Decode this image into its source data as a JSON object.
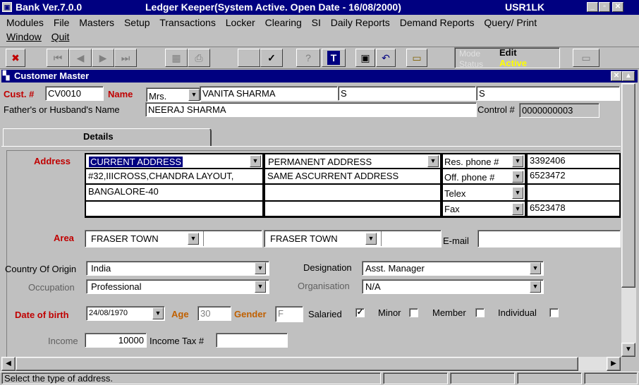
{
  "app": {
    "title_left": "Bank Ver.7.0.0",
    "title_center": "Ledger Keeper(System Active. Open Date - 16/08/2000)",
    "user": "USR1LK"
  },
  "menu": {
    "row1": [
      "Modules",
      "File",
      "Masters",
      "Setup",
      "Transactions",
      "Locker",
      "Clearing",
      "SI",
      "Daily Reports",
      "Demand Reports",
      "Query/ Print"
    ],
    "window": "Window",
    "quit": "Quit"
  },
  "toolbar": {
    "mode_label": "Mode",
    "mode_value": "Edit",
    "status_label": "Status",
    "status_value": "Active",
    "status_color": "#ffff00"
  },
  "child": {
    "title": "Customer Master",
    "close_glyph": "✕"
  },
  "header": {
    "cust_label": "Cust. #",
    "cust_value": "CV0010",
    "name_label": "Name",
    "salutation": "Mrs.",
    "first_name": "VANITA SHARMA",
    "middle": "S",
    "last": "S",
    "father_label": "Father's or Husband's Name",
    "father_value": "NEERAJ SHARMA",
    "control_label": "Control #",
    "control_value": "0000000003"
  },
  "tabs": {
    "details": "Details"
  },
  "address": {
    "label": "Address",
    "current_type": "CURRENT ADDRESS",
    "permanent_type": "PERMANENT ADDRESS",
    "current_lines": [
      "#32,IIICROSS,CHANDRA LAYOUT,",
      "BANGALORE-40",
      ""
    ],
    "permanent_lines": [
      "SAME ASCURRENT ADDRESS",
      "",
      ""
    ],
    "phones": [
      {
        "type": "Res. phone #",
        "value": "3392406"
      },
      {
        "type": "Off. phone #",
        "value": "6523472"
      },
      {
        "type": "Telex",
        "value": ""
      },
      {
        "type": "Fax",
        "value": "6523478"
      }
    ]
  },
  "area": {
    "label": "Area",
    "current": "FRASER TOWN",
    "permanent": "FRASER TOWN",
    "email_label": "E-mail",
    "email_value": ""
  },
  "profile": {
    "country_label": "Country Of Origin",
    "country_value": "India",
    "occupation_label": "Occupation",
    "occupation_value": "Professional",
    "designation_label": "Designation",
    "designation_value": "Asst. Manager",
    "organisation_label": "Organisation",
    "organisation_value": "N/A"
  },
  "personal": {
    "dob_label": "Date of birth",
    "dob_value": "24/08/1970",
    "age_label": "Age",
    "age_value": "30",
    "gender_label": "Gender",
    "gender_value": "F",
    "salaried_label": "Salaried",
    "salaried_mark": "✓",
    "minor_label": "Minor",
    "member_label": "Member",
    "individual_label": "Individual"
  },
  "income": {
    "label": "Income",
    "value": "10000",
    "tax_label": "Income Tax #",
    "tax_value": ""
  },
  "status_bar": {
    "message": "Select the type of address."
  }
}
